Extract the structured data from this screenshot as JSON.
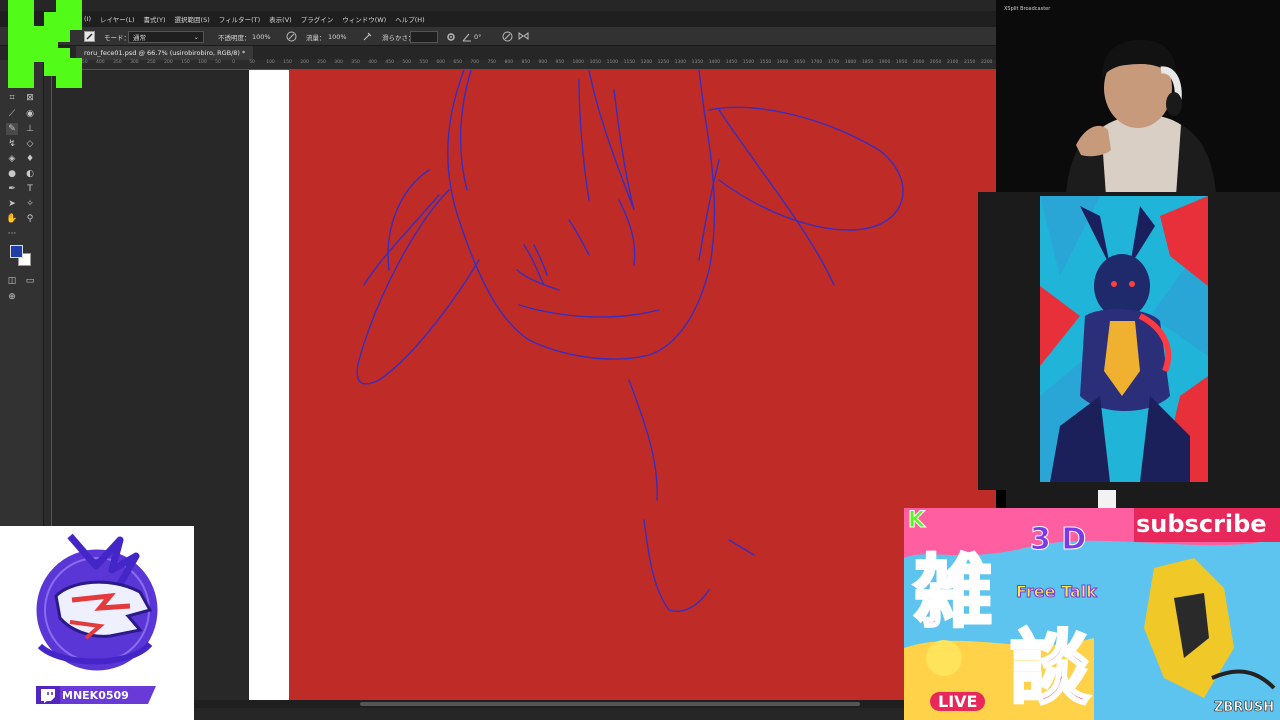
{
  "photoshop": {
    "menu": [
      "(I)",
      "レイヤー(L)",
      "書式(Y)",
      "選択範囲(S)",
      "フィルター(T)",
      "表示(V)",
      "プラグイン",
      "ウィンドウ(W)",
      "ヘルプ(H)"
    ],
    "options": {
      "mode_label": "モード：",
      "mode_value": "通常",
      "opacity_label": "不透明度：",
      "opacity_value": "100%",
      "flow_label": "流量：",
      "flow_value": "100%",
      "smoothing_label": "滑らかさ：",
      "angle_value": "0°"
    },
    "document_tab": "roru_fece01.psd @ 66.7% (usirobirobiro, RGB/8) *",
    "ruler_ticks": [
      "50",
      "450",
      "400",
      "350",
      "300",
      "250",
      "200",
      "150",
      "100",
      "50",
      "0",
      "50",
      "100",
      "150",
      "200",
      "250",
      "300",
      "350",
      "400",
      "450",
      "500",
      "550",
      "600",
      "650",
      "700",
      "750",
      "800",
      "850",
      "900",
      "950",
      "1000",
      "1050",
      "1100",
      "1150",
      "1200",
      "1250",
      "1300",
      "1350",
      "1400",
      "1450",
      "1500",
      "1550",
      "1600",
      "1650",
      "1700",
      "1750",
      "1800",
      "1850",
      "1900",
      "1950",
      "2000",
      "2050",
      "2100",
      "2150",
      "2200"
    ]
  },
  "webcam": {
    "watermark": "XSplit Broadcaster"
  },
  "channel": {
    "name": "MNEK0509"
  },
  "banner": {
    "k": "K",
    "subscribe": "subscribe",
    "three_d": "3 D",
    "zatsu": "雑",
    "dan": "談",
    "free_talk": "Free Talk",
    "live": "LIVE",
    "zbrush": "ZBrush"
  },
  "colors": {
    "canvas_red": "#bf2c27",
    "sketch_blue": "#2a2ecf",
    "k_green": "#53fc18",
    "foreground_swatch": "#1e3ea8"
  }
}
